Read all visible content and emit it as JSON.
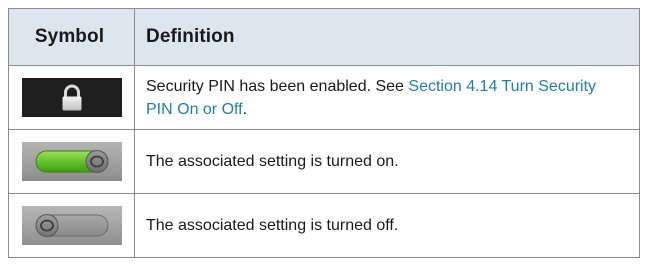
{
  "table": {
    "header": {
      "symbol": "Symbol",
      "definition": "Definition"
    },
    "rows": [
      {
        "icon": "lock-icon",
        "definition_text": "Security PIN has been enabled. See ",
        "link_text": "Section 4.14 Turn Security PIN On or Off",
        "definition_suffix": "."
      },
      {
        "icon": "toggle-on-icon",
        "definition_text": "The associated setting is turned on."
      },
      {
        "icon": "toggle-off-icon",
        "definition_text": "The associated setting is turned off."
      }
    ]
  },
  "colors": {
    "header_bg": "#dde6ef",
    "link": "#1f7fa7",
    "toggle_on": "#6fc23a"
  }
}
